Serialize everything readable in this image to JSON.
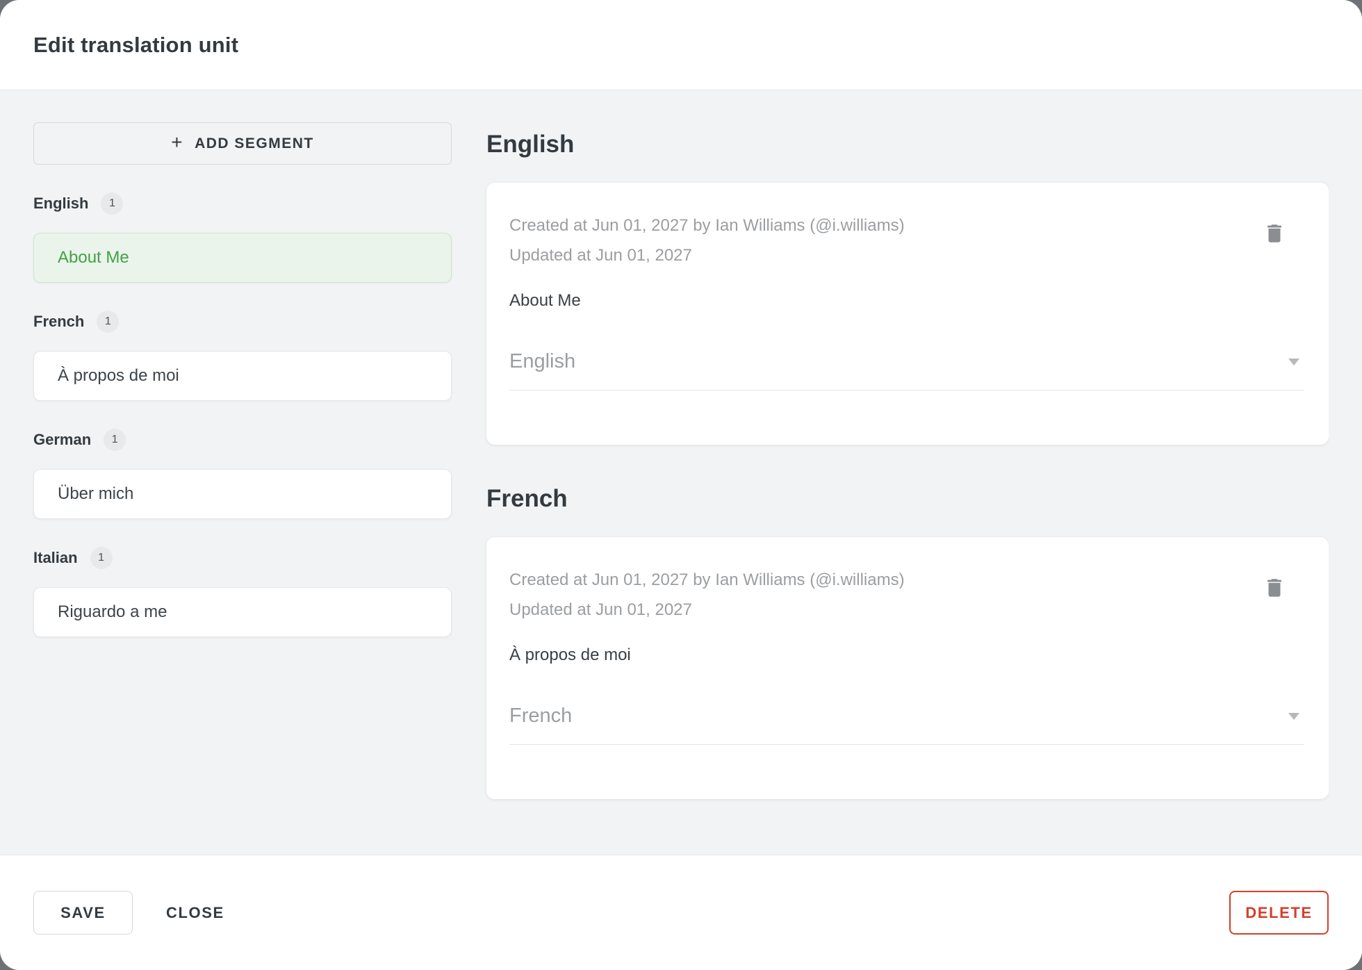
{
  "dialog": {
    "title": "Edit translation unit"
  },
  "sidebar": {
    "add_segment": {
      "plus": "+",
      "label": "ADD SEGMENT"
    },
    "groups": [
      {
        "language": "English",
        "count": "1",
        "text": "About Me",
        "selected": true
      },
      {
        "language": "French",
        "count": "1",
        "text": "À propos de moi",
        "selected": false
      },
      {
        "language": "German",
        "count": "1",
        "text": "Über mich",
        "selected": false
      },
      {
        "language": "Italian",
        "count": "1",
        "text": "Riguardo a me",
        "selected": false
      }
    ]
  },
  "main": {
    "sections": [
      {
        "heading": "English",
        "created": "Created at Jun 01, 2027 by Ian Williams (@i.williams)",
        "updated": "Updated at Jun 01, 2027",
        "text": "About Me",
        "language_select": "English"
      },
      {
        "heading": "French",
        "created": "Created at Jun 01, 2027 by Ian Williams (@i.williams)",
        "updated": "Updated at Jun 01, 2027",
        "text": "À propos de moi",
        "language_select": "French"
      }
    ]
  },
  "footer": {
    "save_label": "SAVE",
    "close_label": "CLOSE",
    "delete_label": "DELETE"
  },
  "icons": {
    "add_segment": "plus-icon",
    "card_delete": "trash-icon",
    "select_dropdown": "chevron-down-icon"
  },
  "colors": {
    "backdrop": "#6e7276",
    "body_background": "#f1f3f4",
    "selected_green_text": "#43a047",
    "selected_green_bg": "#eaf4ea",
    "delete_red": "#d2402e",
    "muted_text": "#9b9ea1",
    "dark_text": "#333a40"
  }
}
